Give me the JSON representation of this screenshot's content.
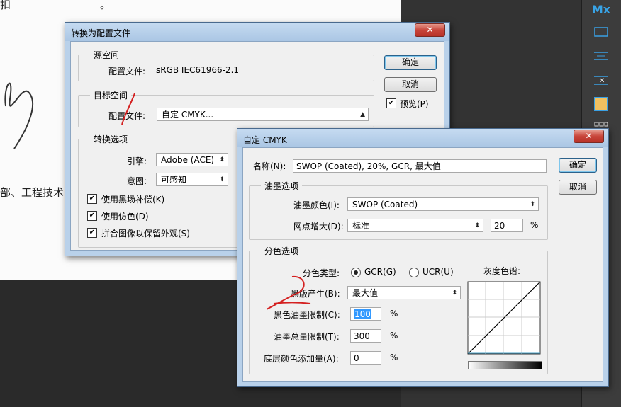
{
  "background_doc": {
    "line1_prefix": "扣",
    "line1_sep": "/",
    "line1_suffix": "。",
    "line2": "部、工程技术"
  },
  "right_panel": {
    "icons": [
      "mx-logo-icon",
      "frame-icon",
      "align-lines-icon",
      "delete-lines-icon",
      "square-icon",
      "grid-icon"
    ],
    "logo_text": "Mx"
  },
  "convert_dialog": {
    "title": "转换为配置文件",
    "close_label": "✕",
    "source_group": "源空间",
    "source_profile_label": "配置文件:",
    "source_profile_value": "sRGB IEC61966-2.1",
    "target_group": "目标空间",
    "target_profile_label": "配置文件:",
    "target_profile_value": "自定 CMYK...",
    "options_group": "转换选项",
    "engine_label": "引擎:",
    "engine_value": "Adobe (ACE)",
    "intent_label": "意图:",
    "intent_value": "可感知",
    "checkbox_blackpoint": "使用黑场补偿(K)",
    "checkbox_dither": "使用仿色(D)",
    "checkbox_flatten": "拼合图像以保留外观(S)",
    "ok": "确定",
    "cancel": "取消",
    "preview": "预览(P)"
  },
  "cmyk_dialog": {
    "title": "自定 CMYK",
    "close_label": "✕",
    "name_label": "名称(N):",
    "name_value": "SWOP (Coated), 20%, GCR, 最大值",
    "ok": "确定",
    "cancel": "取消",
    "ink_group": "油墨选项",
    "ink_colors_label": "油墨颜色(I):",
    "ink_colors_value": "SWOP (Coated)",
    "dot_gain_label": "网点增大(D):",
    "dot_gain_value": "标准",
    "dot_gain_amount": "20",
    "percent": "%",
    "sep_group": "分色选项",
    "sep_type_label": "分色类型:",
    "gcr_label": "GCR(G)",
    "ucr_label": "UCR(U)",
    "gray_ramp_label": "灰度色谱:",
    "black_gen_label": "黑版产生(B):",
    "black_gen_value": "最大值",
    "black_ink_limit_label": "黑色油墨限制(C):",
    "black_ink_limit_value": "100",
    "total_ink_limit_label": "油墨总量限制(T):",
    "total_ink_limit_value": "300",
    "ucr_amount_label": "底层颜色添加量(A):",
    "ucr_amount_value": "0"
  }
}
